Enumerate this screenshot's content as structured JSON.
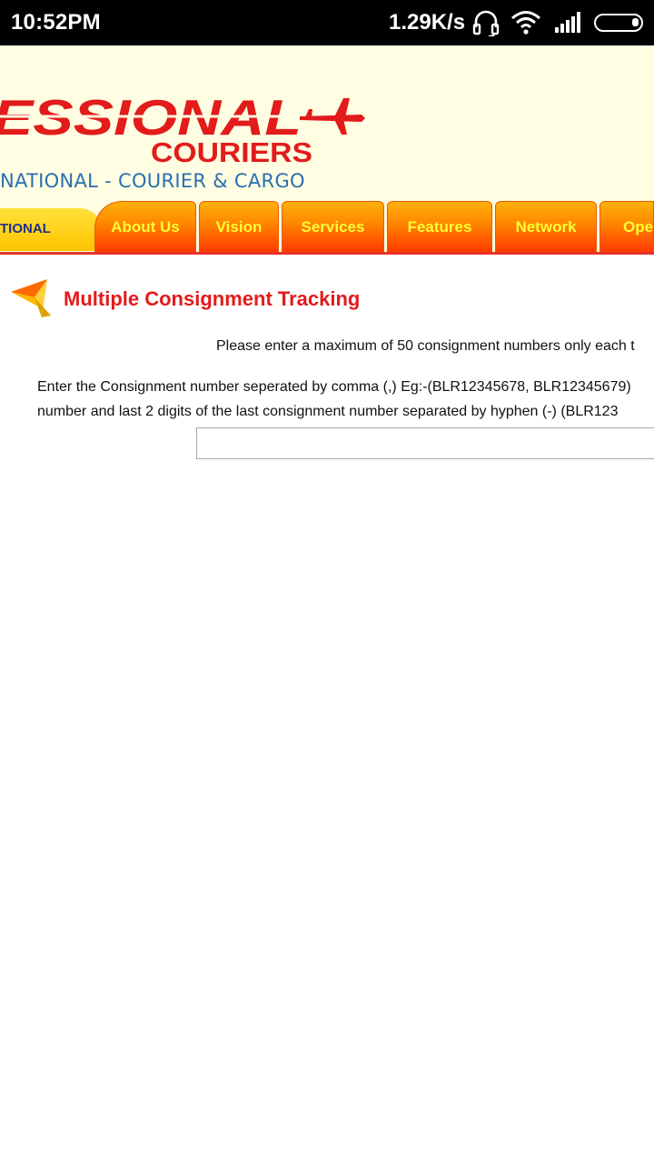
{
  "status_bar": {
    "time": "10:52PM",
    "network_speed": "1.29K/s",
    "icons": [
      "headset-icon",
      "wifi-icon",
      "signal-icon",
      "battery-icon"
    ]
  },
  "header": {
    "logo_text": "ESSIONAL",
    "logo_subtext": "COURIERS",
    "tagline": "NATIONAL  -  COURIER & CARGO"
  },
  "nav": {
    "active_label": "TIONAL",
    "tabs": [
      {
        "label": "About Us"
      },
      {
        "label": "Vision"
      },
      {
        "label": "Services"
      },
      {
        "label": "Features"
      },
      {
        "label": "Network"
      },
      {
        "label": "Oper"
      }
    ]
  },
  "content": {
    "title": "Multiple Consignment Tracking",
    "instruction": "Please enter a maximum of 50 consignment numbers only each t",
    "help_line_1": "Enter the Consignment number seperated by comma (,) Eg:-(BLR12345678, BLR12345679)",
    "help_line_2": "number and last 2 digits of the last consignment number separated by hyphen (-)  (BLR123",
    "input_value": ""
  },
  "colors": {
    "header_bg": "#fffde2",
    "logo_red": "#e21b1b",
    "tagline_blue": "#2a6fb2",
    "tab_text": "#ffff33",
    "title_red": "#e21b1b"
  }
}
